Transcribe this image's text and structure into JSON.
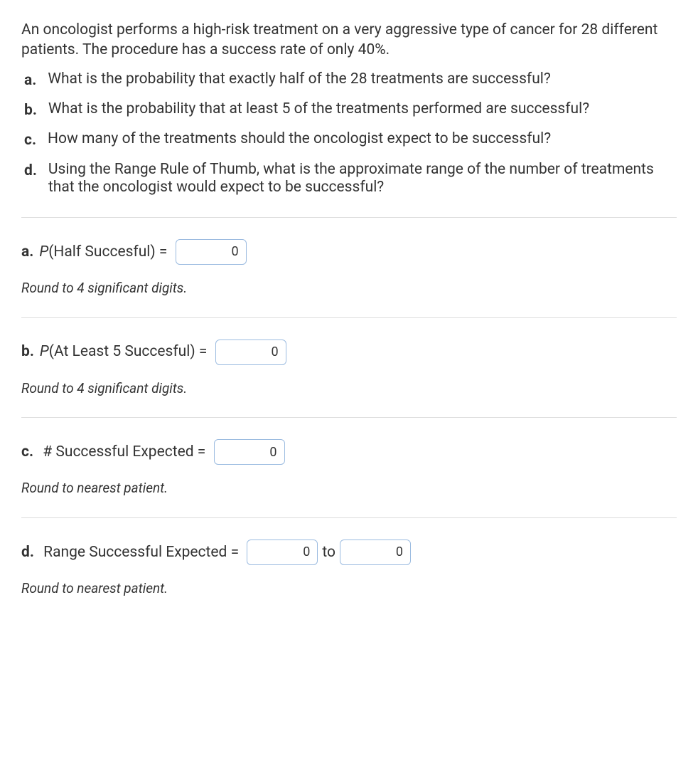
{
  "intro": "An oncologist performs a high-risk treatment on a very aggressive type of cancer for 28 different patients. The procedure has a success rate of only 40%.",
  "questions": {
    "a": {
      "marker": "a.",
      "text": "What is the probability that exactly half of the 28 treatments are successful?"
    },
    "b": {
      "marker": "b.",
      "text": "What is the probability that at least 5 of the treatments performed are successful?"
    },
    "c": {
      "marker": "c.",
      "text": "How many of the treatments should the oncologist expect to be successful?"
    },
    "d": {
      "marker": "d.",
      "text": "Using the Range Rule of Thumb, what is the approximate range of the number of treatments that the oncologist would expect to be successful?"
    }
  },
  "answers": {
    "a": {
      "lead": "a.",
      "p": "P",
      "label": "(Half Succesful) = ",
      "value": "0",
      "hint": "Round to 4 significant digits."
    },
    "b": {
      "lead": "b.",
      "p": "P",
      "label": "(At Least 5 Succesful) = ",
      "value": "0",
      "hint": "Round to 4 significant digits."
    },
    "c": {
      "lead": "c.",
      "label": " # Successful Expected = ",
      "value": "0",
      "hint": "Round to nearest patient."
    },
    "d": {
      "lead": "d.",
      "label": " Range Successful Expected = ",
      "value_lo": "0",
      "to": " to ",
      "value_hi": "0",
      "hint": "Round to nearest patient."
    }
  }
}
